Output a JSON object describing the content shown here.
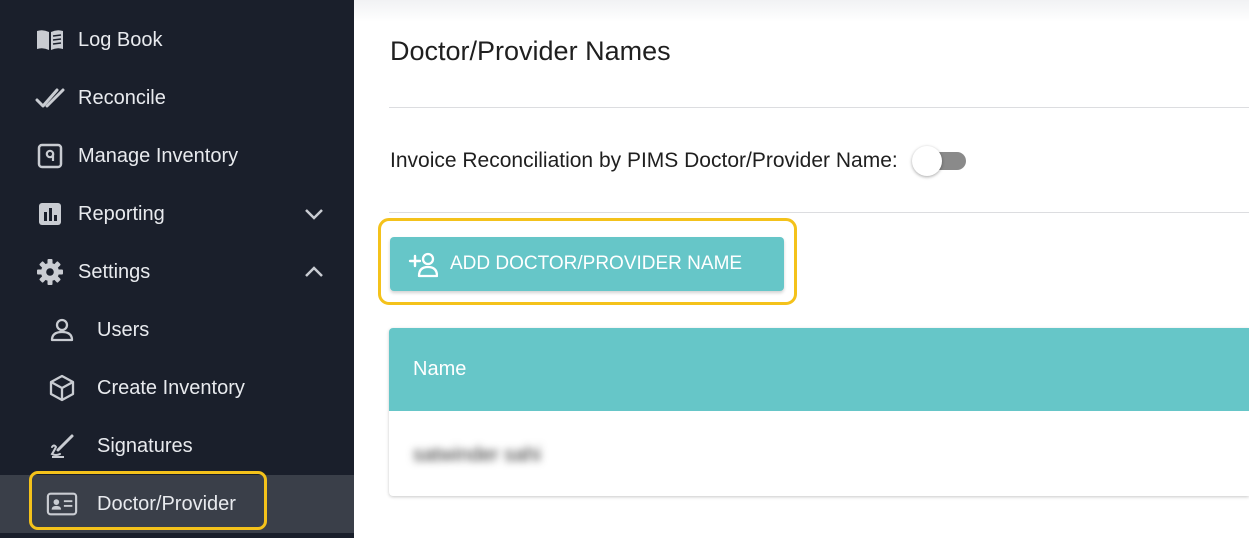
{
  "sidebar": {
    "items": [
      {
        "label": "Log Book",
        "icon": "book-icon"
      },
      {
        "label": "Reconcile",
        "icon": "double-check-icon"
      },
      {
        "label": "Manage Inventory",
        "icon": "inventory-icon"
      },
      {
        "label": "Reporting",
        "icon": "bar-chart-icon",
        "expanded": false
      },
      {
        "label": "Settings",
        "icon": "gear-icon",
        "expanded": true
      },
      {
        "label": "Users",
        "icon": "user-icon"
      },
      {
        "label": "Create Inventory",
        "icon": "cube-icon"
      },
      {
        "label": "Signatures",
        "icon": "pen-icon"
      },
      {
        "label": "Doctor/Provider",
        "icon": "id-card-icon",
        "active": true
      }
    ]
  },
  "main": {
    "title": "Doctor/Provider Names",
    "toggle_label": "Invoice Reconciliation by PIMS Doctor/Provider Name:",
    "toggle_on": false,
    "add_button_label": "ADD DOCTOR/PROVIDER NAME",
    "table": {
      "columns": [
        "Name"
      ],
      "rows": [
        [
          "satwinder sahi"
        ]
      ]
    }
  },
  "colors": {
    "sidebar_bg": "#1a1f2b",
    "active_item_bg": "#3a3f49",
    "accent_teal": "#66c6c8",
    "highlight": "#f4c21b"
  }
}
